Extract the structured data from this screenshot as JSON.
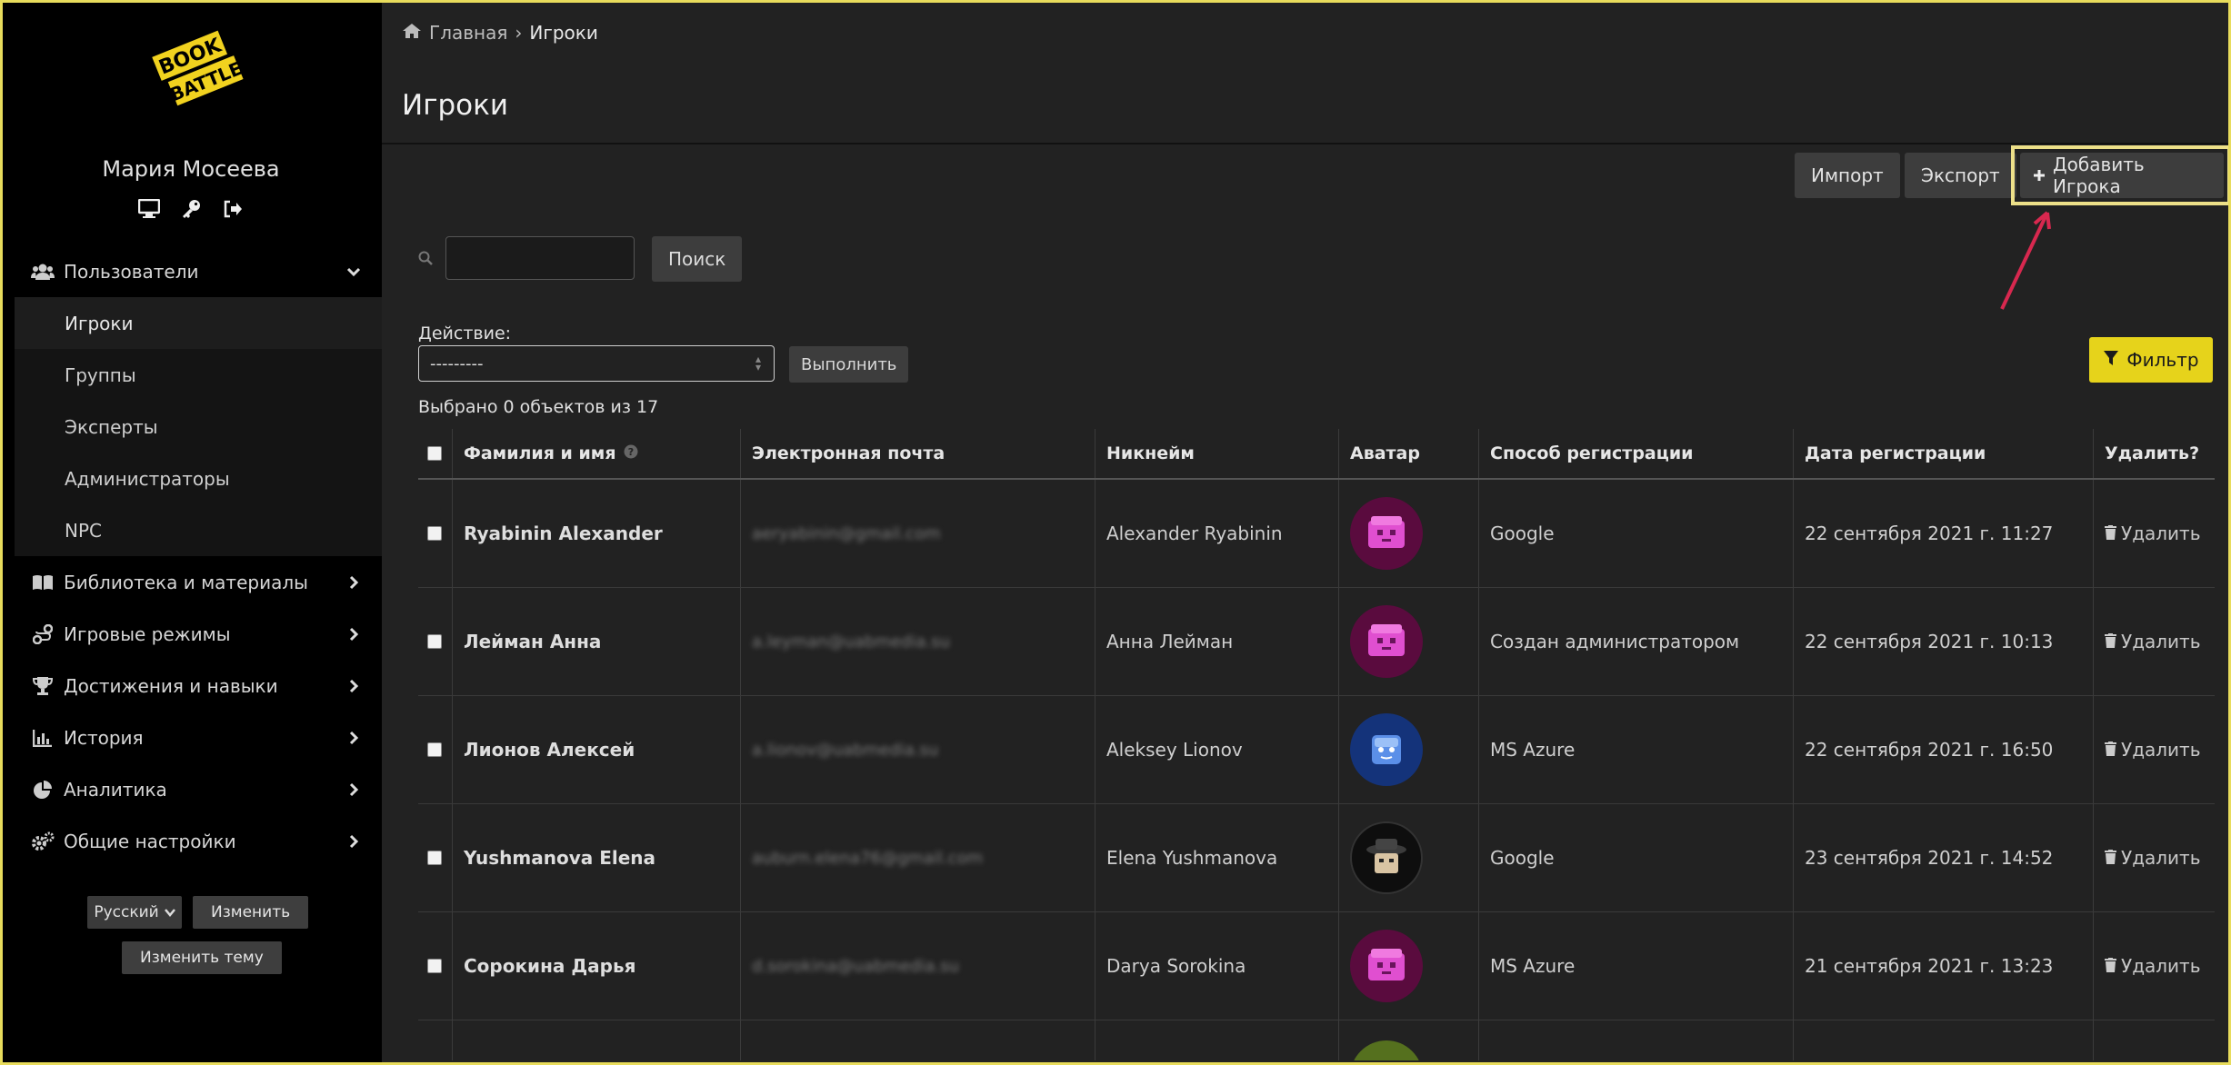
{
  "brand": {
    "logo_text": "BOOK BATTLE"
  },
  "user": {
    "name": "Мария Мосеева",
    "icons": [
      "monitor-icon",
      "key-icon",
      "sign-out-icon"
    ]
  },
  "sidebar": {
    "users_section": {
      "label": "Пользователи",
      "icon": "users-icon"
    },
    "sub_items": [
      "Игроки",
      "Группы",
      "Эксперты",
      "Администраторы",
      "NPC"
    ],
    "active_sub": "Игроки",
    "sections": [
      {
        "label": "Библиотека и материалы",
        "icon": "book-icon"
      },
      {
        "label": "Игровые режимы",
        "icon": "route-icon"
      },
      {
        "label": "Достижения и навыки",
        "icon": "trophy-icon"
      },
      {
        "label": "История",
        "icon": "chart-icon"
      },
      {
        "label": "Аналитика",
        "icon": "pie-chart-icon"
      },
      {
        "label": "Общие настройки",
        "icon": "gears-icon"
      }
    ],
    "language": "Русский",
    "change_label": "Изменить",
    "change_theme_label": "Изменить тему"
  },
  "breadcrumb": {
    "home": "Главная",
    "separator": "›",
    "current": "Игроки"
  },
  "page": {
    "title": "Игроки"
  },
  "toolbar": {
    "import_label": "Импорт",
    "export_label": "Экспорт",
    "add_label": "Добавить Игрока",
    "add_icon": "plus-icon"
  },
  "search": {
    "value": "",
    "button_label": "Поиск"
  },
  "actions": {
    "label": "Действие:",
    "selected": "---------",
    "run_label": "Выполнить"
  },
  "filter": {
    "label": "Фильтр",
    "icon": "filter-icon"
  },
  "selection": {
    "text": "Выбрано 0 объектов из 17"
  },
  "table": {
    "headers": [
      "Фамилия и имя",
      "Электронная почта",
      "Никнейм",
      "Аватар",
      "Способ регистрации",
      "Дата регистрации",
      "Удалить?"
    ],
    "rows": [
      {
        "name": "Ryabinin Alexander",
        "email": "aeryabinin@gmail.com",
        "nickname": "Alexander Ryabinin",
        "avatar": "pink-box",
        "method": "Google",
        "date": "22 сентября 2021 г. 11:27",
        "delete": "Удалить"
      },
      {
        "name": "Лейман Анна",
        "email": "a.leyman@uabmedia.su",
        "nickname": "Анна Лейман",
        "avatar": "pink-box",
        "method": "Создан администратором",
        "date": "22 сентября 2021 г. 10:13",
        "delete": "Удалить"
      },
      {
        "name": "Лионов Алексей",
        "email": "a.lionov@uabmedia.su",
        "nickname": "Aleksey Lionov",
        "avatar": "blue-cube",
        "method": "MS Azure",
        "date": "22 сентября 2021 г. 16:50",
        "delete": "Удалить"
      },
      {
        "name": "Yushmanova Elena",
        "email": "auburn.elena76@gmail.com",
        "nickname": "Elena Yushmanova",
        "avatar": "hat-character",
        "method": "Google",
        "date": "23 сентября 2021 г. 14:52",
        "delete": "Удалить"
      },
      {
        "name": "Сорокина Дарья",
        "email": "d.sorokina@uabmedia.su",
        "nickname": "Darya Sorokina",
        "avatar": "pink-box",
        "method": "MS Azure",
        "date": "21 сентября 2021 г. 13:23",
        "delete": "Удалить"
      }
    ]
  },
  "colors": {
    "accent_yellow": "#e6d31b",
    "highlight_border": "#ede089",
    "annotation_arrow": "#d8284f"
  }
}
